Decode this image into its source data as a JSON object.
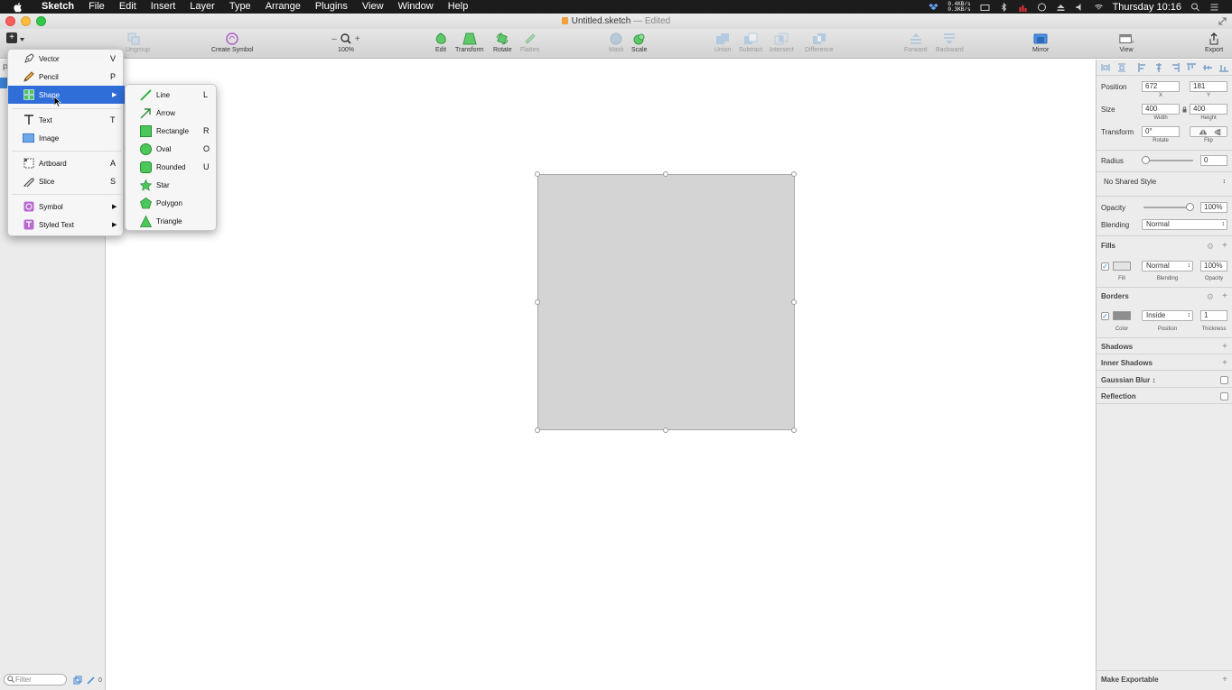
{
  "menubar": {
    "app": "Sketch",
    "items": [
      "File",
      "Edit",
      "Insert",
      "Layer",
      "Type",
      "Arrange",
      "Plugins",
      "View",
      "Window",
      "Help"
    ],
    "net_up": "0.4KB/s",
    "net_down": "0.3KB/s",
    "clock": "Thursday 10:16"
  },
  "window": {
    "title": "Untitled.sketch",
    "status": "— Edited"
  },
  "toolbar": {
    "ungroup": "Ungroup",
    "create_symbol": "Create Symbol",
    "zoom": "100%",
    "zoom_minus": "–",
    "zoom_plus": "+",
    "edit": "Edit",
    "transform": "Transform",
    "rotate": "Rotate",
    "flatten": "Flatten",
    "mask": "Mask",
    "scale": "Scale",
    "union": "Union",
    "subtract": "Subtract",
    "intersect": "Intersect",
    "difference": "Difference",
    "forward": "Forward",
    "backward": "Backward",
    "mirror": "Mirror",
    "view": "View",
    "export": "Export"
  },
  "leftpanel": {
    "pages_label": "P",
    "filter_placeholder": "Filter",
    "count": "0"
  },
  "insert_menu": {
    "items": [
      {
        "label": "Vector",
        "key": "V"
      },
      {
        "label": "Pencil",
        "key": "P"
      },
      {
        "label": "Shape",
        "key": ""
      },
      {
        "label": "Text",
        "key": "T"
      },
      {
        "label": "Image",
        "key": ""
      },
      {
        "label": "Artboard",
        "key": "A"
      },
      {
        "label": "Slice",
        "key": "S"
      },
      {
        "label": "Symbol",
        "key": ""
      },
      {
        "label": "Styled Text",
        "key": ""
      }
    ]
  },
  "shape_menu": {
    "items": [
      {
        "label": "Line",
        "key": "L"
      },
      {
        "label": "Arrow",
        "key": ""
      },
      {
        "label": "Rectangle",
        "key": "R"
      },
      {
        "label": "Oval",
        "key": "O"
      },
      {
        "label": "Rounded",
        "key": "U"
      },
      {
        "label": "Star",
        "key": ""
      },
      {
        "label": "Polygon",
        "key": ""
      },
      {
        "label": "Triangle",
        "key": ""
      }
    ]
  },
  "inspector": {
    "position_label": "Position",
    "x": "672",
    "y": "181",
    "x_label": "X",
    "y_label": "Y",
    "size_label": "Size",
    "width": "400",
    "height": "400",
    "width_label": "Width",
    "height_label": "Height",
    "transform_label": "Transform",
    "rotate": "0°",
    "rotate_label": "Rotate",
    "flip_label": "Flip",
    "radius_label": "Radius",
    "radius": "0",
    "shared_style": "No Shared Style",
    "opacity_label": "Opacity",
    "opacity": "100%",
    "blending_label": "Blending",
    "blending": "Normal",
    "fills_label": "Fills",
    "fill_label": "Fill",
    "fill_blending": "Normal",
    "fill_blending_label": "Blending",
    "fill_opacity": "100%",
    "fill_opacity_label": "Opacity",
    "borders_label": "Borders",
    "border_color_label": "Color",
    "border_position": "Inside",
    "border_position_label": "Position",
    "border_thickness": "1",
    "border_thickness_label": "Thickness",
    "shadows_label": "Shadows",
    "inner_shadows_label": "Inner Shadows",
    "gaussian_blur_label": "Gaussian Blur",
    "reflection_label": "Reflection",
    "make_exportable": "Make Exportable"
  },
  "colors": {
    "highlight": "#2f6ed9",
    "shape_fill": "#d4d4d4",
    "menu_icon_green": "#4cc85a"
  }
}
